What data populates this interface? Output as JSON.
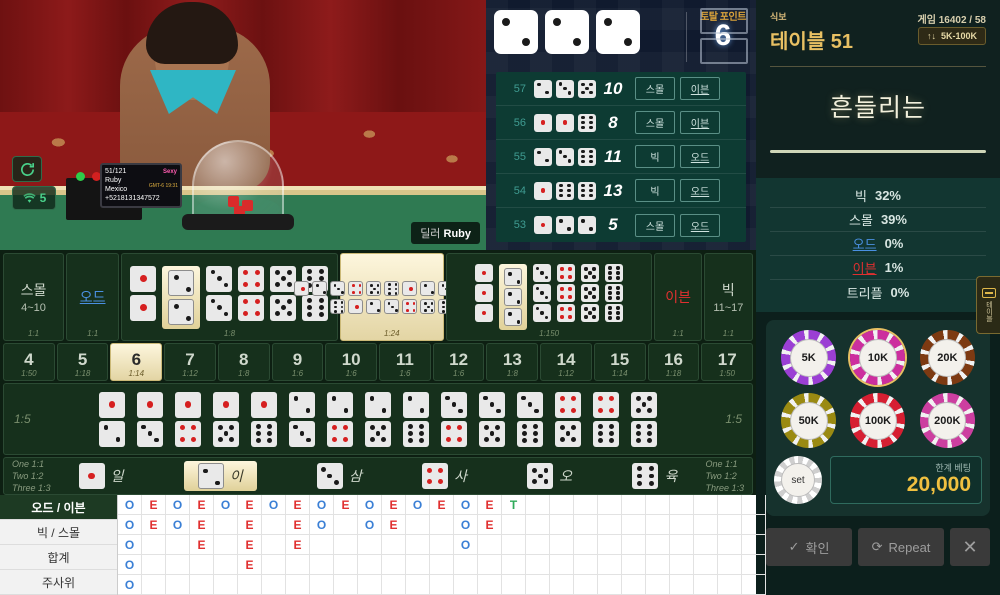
{
  "video": {
    "dealer_badge_label": "딜러",
    "dealer_name": "Ruby",
    "monitor_line1": "51/121",
    "monitor_line2": "Ruby",
    "monitor_line3": "Mexico",
    "monitor_line4": "+5218131347572",
    "monitor_brand": "Sexy",
    "monitor_time": "GMT-6 19:31",
    "refresh_icon": "refresh-icon",
    "signal_icon": "wifi-icon",
    "signal_level": "5"
  },
  "history": {
    "total_label": "토탈 포인트",
    "total_value": "6",
    "current_dice": [
      2,
      2,
      2
    ],
    "rows": [
      {
        "id": "57",
        "dice": [
          2,
          3,
          5
        ],
        "sum": "10",
        "tag1": "스몰",
        "tag2": "이븐"
      },
      {
        "id": "56",
        "dice": [
          1,
          1,
          6
        ],
        "sum": "8",
        "tag1": "스몰",
        "tag2": "이븐"
      },
      {
        "id": "55",
        "dice": [
          2,
          3,
          6
        ],
        "sum": "11",
        "tag1": "빅",
        "tag2": "오드"
      },
      {
        "id": "54",
        "dice": [
          1,
          6,
          6
        ],
        "sum": "13",
        "tag1": "빅",
        "tag2": "오드"
      },
      {
        "id": "53",
        "dice": [
          1,
          2,
          2
        ],
        "sum": "5",
        "tag1": "스몰",
        "tag2": "오드"
      }
    ]
  },
  "right_panel": {
    "game_label": "식보",
    "table_title": "테이블 51",
    "game_counter": "게임 16402 / 58",
    "limit_label": "5K-100K",
    "limit_icon": "updown-arrow-icon",
    "status_text": "흔들리는",
    "stats": [
      {
        "label": "빅",
        "value": "32%",
        "color": "#d8e6e2"
      },
      {
        "label": "스몰",
        "value": "39%",
        "color": "#d8e6e2"
      },
      {
        "label": "오드",
        "value": "0%",
        "color": "#4a90e2"
      },
      {
        "label": "이븐",
        "value": "1%",
        "color": "#e03030"
      },
      {
        "label": "트리플",
        "value": "0%",
        "color": "#d8e6e2"
      }
    ],
    "chips": [
      {
        "label": "5K",
        "ring": "#9b3fd4",
        "selected": false
      },
      {
        "label": "10K",
        "ring": "#cc2f9e",
        "selected": true
      },
      {
        "label": "20K",
        "ring": "#7d3a12",
        "selected": false
      },
      {
        "label": "50K",
        "ring": "#9a8a12",
        "selected": false
      },
      {
        "label": "100K",
        "ring": "#d61f32",
        "selected": false
      },
      {
        "label": "200K",
        "ring": "#cc3fa0",
        "selected": false
      }
    ],
    "set_chip_label": "set",
    "bet_limit_label": "한계 베팅",
    "bet_limit_value": "20,000",
    "confirm_label": "확인",
    "repeat_label": "Repeat",
    "close_label": "✕",
    "side_tab_label": "테이블"
  },
  "board": {
    "small": {
      "title": "스몰",
      "range": "4~10",
      "odds": "1:1"
    },
    "odd": {
      "title": "오드",
      "odds": "1:1",
      "color": "#4a90e2"
    },
    "even": {
      "title": "이븐",
      "odds": "1:1",
      "color": "#e03030"
    },
    "big": {
      "title": "빅",
      "range": "11~17",
      "odds": "1:1"
    },
    "pairs_odds": "1:8",
    "pairs": [
      1,
      2,
      3,
      4,
      5,
      6
    ],
    "pairs_highlight_index": 1,
    "any_triple_odds": "1:24",
    "triples_odds": "1:150",
    "triples": [
      1,
      2,
      3,
      4,
      5,
      6
    ],
    "triples_highlight_index": 1,
    "numbers": [
      {
        "n": "4",
        "odds": "1:50",
        "hl": false
      },
      {
        "n": "5",
        "odds": "1:18",
        "hl": false
      },
      {
        "n": "6",
        "odds": "1:14",
        "hl": true
      },
      {
        "n": "7",
        "odds": "1:12",
        "hl": false
      },
      {
        "n": "8",
        "odds": "1:8",
        "hl": false
      },
      {
        "n": "9",
        "odds": "1:6",
        "hl": false
      },
      {
        "n": "10",
        "odds": "1:6",
        "hl": false
      },
      {
        "n": "11",
        "odds": "1:6",
        "hl": false
      },
      {
        "n": "12",
        "odds": "1:6",
        "hl": false
      },
      {
        "n": "13",
        "odds": "1:8",
        "hl": false
      },
      {
        "n": "14",
        "odds": "1:12",
        "hl": false
      },
      {
        "n": "15",
        "odds": "1:14",
        "hl": false
      },
      {
        "n": "16",
        "odds": "1:18",
        "hl": false
      },
      {
        "n": "17",
        "odds": "1:50",
        "hl": false
      }
    ],
    "combo_odds_left": "1:5",
    "combo_odds_right": "1:5",
    "combos": [
      [
        1,
        2
      ],
      [
        1,
        3
      ],
      [
        1,
        4
      ],
      [
        1,
        5
      ],
      [
        1,
        6
      ],
      [
        2,
        3
      ],
      [
        2,
        4
      ],
      [
        2,
        5
      ],
      [
        2,
        6
      ],
      [
        3,
        4
      ],
      [
        3,
        5
      ],
      [
        3,
        6
      ],
      [
        4,
        5
      ],
      [
        4,
        6
      ],
      [
        5,
        6
      ]
    ],
    "single_odds_lines": [
      "One 1:1",
      "Two 1:2",
      "Three 1:3"
    ],
    "singles": [
      {
        "face": 1,
        "label": "일",
        "hl": false
      },
      {
        "face": 2,
        "label": "이",
        "hl": true
      },
      {
        "face": 3,
        "label": "삼",
        "hl": false
      },
      {
        "face": 4,
        "label": "사",
        "hl": false
      },
      {
        "face": 5,
        "label": "오",
        "hl": false
      },
      {
        "face": 6,
        "label": "육",
        "hl": false
      }
    ]
  },
  "road": {
    "tabs": [
      {
        "label": "오드 / 이븐",
        "active": true
      },
      {
        "label": "빅 / 스몰",
        "active": false
      },
      {
        "label": "합계",
        "active": false
      },
      {
        "label": "주사위",
        "active": false
      }
    ],
    "columns": [
      [
        "O",
        "O",
        "O",
        "O",
        "O"
      ],
      [
        "E",
        "E"
      ],
      [
        "O",
        "O"
      ],
      [
        "E",
        "E",
        "E"
      ],
      [
        "O"
      ],
      [
        "E",
        "E",
        "E",
        "E"
      ],
      [
        "O"
      ],
      [
        "E",
        "E",
        "E"
      ],
      [
        "O",
        "O"
      ],
      [
        "E"
      ],
      [
        "O",
        "O"
      ],
      [
        "E",
        "E"
      ],
      [
        "O"
      ],
      [
        "E"
      ],
      [
        "O",
        "O",
        "O"
      ],
      [
        "E",
        "E"
      ],
      [
        "T"
      ]
    ]
  }
}
